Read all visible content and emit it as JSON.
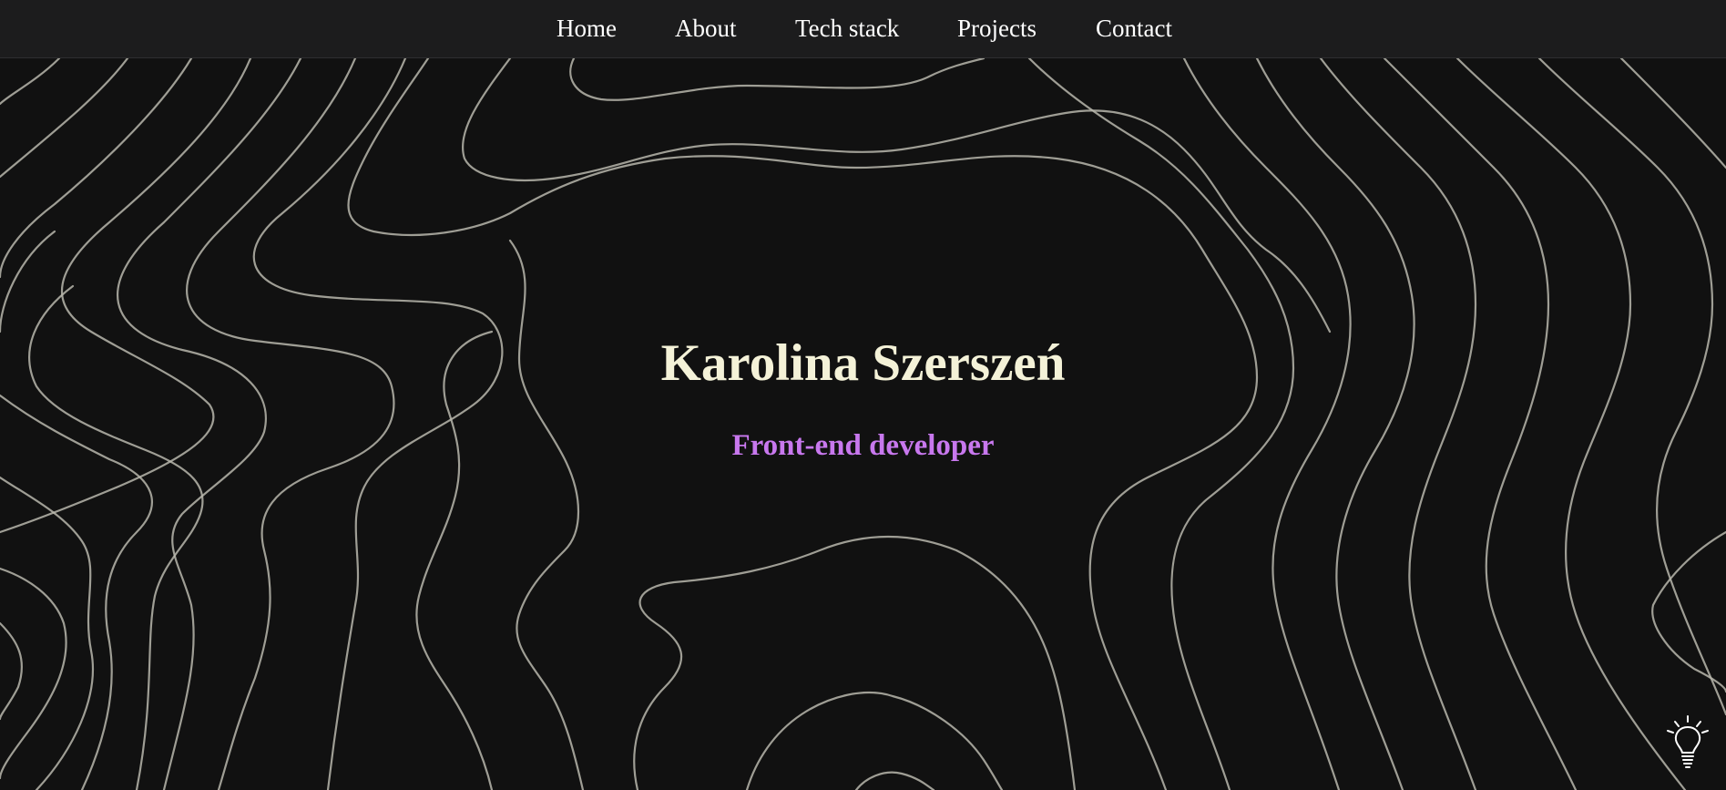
{
  "nav": {
    "items": [
      {
        "label": "Home"
      },
      {
        "label": "About"
      },
      {
        "label": "Tech stack"
      },
      {
        "label": "Projects"
      },
      {
        "label": "Contact"
      }
    ]
  },
  "hero": {
    "title": "Karolina Szerszeń",
    "subtitle": "Front-end developer"
  },
  "theme_toggle": {
    "icon": "lightbulb-icon"
  },
  "colors": {
    "background": "#111111",
    "navbar": "#1c1c1d",
    "contour_lines": "#b9b7ad",
    "title": "#f4f2d8",
    "subtitle": "#c878ee"
  }
}
